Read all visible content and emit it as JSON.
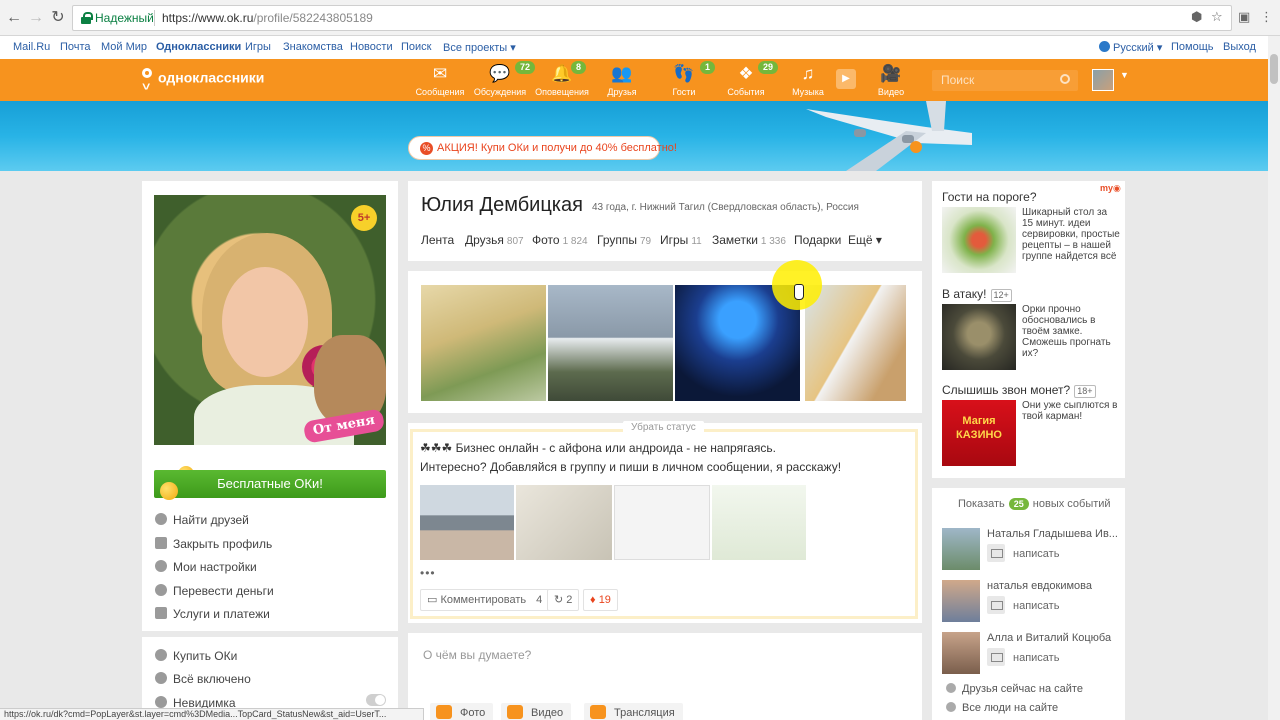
{
  "browser": {
    "secure_label": "Надежный",
    "url_host": "https://www.ok.ru",
    "url_path": "/profile/582243805189"
  },
  "mailbar": {
    "links": [
      "Mail.Ru",
      "Почта",
      "Мой Мир",
      "Одноклассники",
      "Игры",
      "Знакомства",
      "Новости",
      "Поиск",
      "Все проекты ▾"
    ],
    "language": "Русский ▾",
    "help": "Помощь",
    "logout": "Выход"
  },
  "topbar": {
    "logo": "одноклассники",
    "items": [
      {
        "label": "Сообщения",
        "icon": "envelope-icon",
        "badge": ""
      },
      {
        "label": "Обсуждения",
        "icon": "chat-icon",
        "badge": "72"
      },
      {
        "label": "Оповещения",
        "icon": "bell-icon",
        "badge": "8"
      },
      {
        "label": "Друзья",
        "icon": "friends-icon",
        "badge": ""
      },
      {
        "label": "Гости",
        "icon": "footprints-icon",
        "badge": "1"
      },
      {
        "label": "События",
        "icon": "events-icon",
        "badge": "29"
      },
      {
        "label": "Музыка",
        "icon": "music-note-icon",
        "badge": ""
      },
      {
        "label": "Видео",
        "icon": "video-camera-icon",
        "badge": ""
      }
    ],
    "search_placeholder": "Поиск"
  },
  "banner": {
    "promo_icon": "%",
    "promo_text": "АКЦИЯ! Купи ОКи и получи до 40% бесплатно!"
  },
  "profile": {
    "age_badge": "5+",
    "sticker": "От меня",
    "name": "Юлия Дембицкая",
    "meta": "43 года, г. Нижний Тагил (Свердловская область), Россия",
    "tabs": [
      {
        "label": "Лента",
        "count": ""
      },
      {
        "label": "Друзья",
        "count": "807"
      },
      {
        "label": "Фото",
        "count": "1 824"
      },
      {
        "label": "Группы",
        "count": "79"
      },
      {
        "label": "Игры",
        "count": "11"
      },
      {
        "label": "Заметки",
        "count": "1 336"
      },
      {
        "label": "Подарки",
        "count": ""
      },
      {
        "label": "Ещё ▾",
        "count": ""
      }
    ]
  },
  "sidebar": {
    "free_ok": "Бесплатные ОКи!",
    "menu1": [
      "Найти друзей",
      "Закрыть профиль",
      "Мои настройки",
      "Перевести деньги",
      "Услуги и платежи"
    ],
    "menu2": [
      "Купить ОКи",
      "Всё включено",
      "Невидимка"
    ]
  },
  "status": {
    "remove_label": "Убрать статус",
    "line1": "☘☘☘ Бизнес онлайн - с айфона или андроида - не напрягаясь.",
    "line2": "Интересно? Добавляйся в группу и пиши в личном сообщении, я расскажу!",
    "more": "•••",
    "comment_label": "Комментировать",
    "comment_count": "4",
    "share_count": "2",
    "like_count": "19"
  },
  "post": {
    "placeholder": "О чём вы думаете?",
    "buttons": [
      "Фото",
      "Видео",
      "Трансляция"
    ]
  },
  "right": {
    "blocks": [
      {
        "title": "Гости на пороге?",
        "age": "",
        "text": "Шикарный стол за 15 минут. идеи сервировки, простые рецепты – в нашей группе найдется всё"
      },
      {
        "title": "В атаку!",
        "age": "12+",
        "text": "Орки прочно обосновались в твоём замке. Сможешь прогнать их?"
      },
      {
        "title": "Слышишь звон монет?",
        "age": "18+",
        "text": "Они уже сыплются в твой карман!"
      }
    ],
    "casino_text": "Магия КАЗИНО",
    "events_prefix": "Показать",
    "events_count": "25",
    "events_suffix": "новых событий",
    "friends": [
      {
        "name": "Наталья Гладышева Ив...",
        "action": "написать"
      },
      {
        "name": "наталья евдокимова",
        "action": "написать"
      },
      {
        "name": "Алла и Виталий Коцюба",
        "action": "написать"
      }
    ],
    "online_links": [
      "Друзья сейчас на сайте",
      "Все люди на сайте"
    ]
  },
  "statusbar": "https://ok.ru/dk?cmd=PopLayer&st.layer=cmd%3DMedia...TopCard_StatusNew&st_aid=UserT...",
  "colors": {
    "brand": "#f7931e",
    "link": "#2b5ea5",
    "badge": "#75b73b"
  }
}
